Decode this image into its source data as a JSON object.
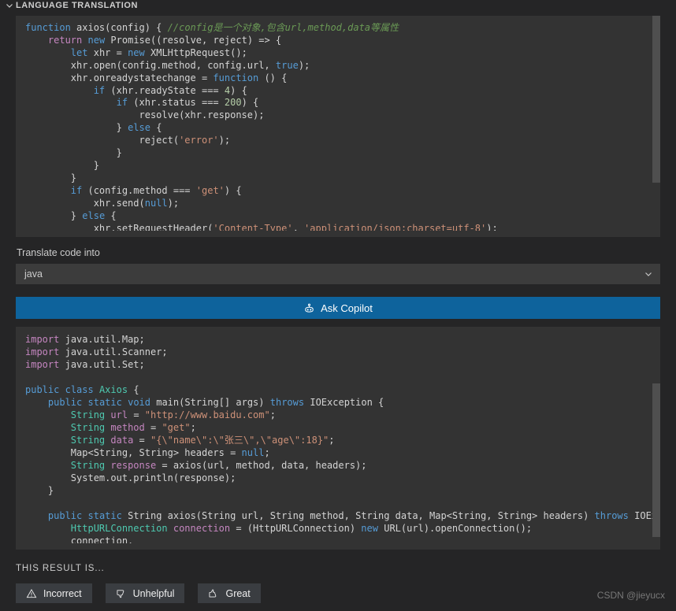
{
  "section": {
    "title": "LANGUAGE TRANSLATION",
    "chevron_icon": "chevron-down-icon"
  },
  "source_code": {
    "language": "javascript",
    "scrollbar": "vertical-scrollbar",
    "text": "function axios(config) { //config是一个对象,包含url,method,data等属性\n    return new Promise((resolve, reject) => {\n        let xhr = new XMLHttpRequest();\n        xhr.open(config.method, config.url, true);\n        xhr.onreadystatechange = function () {\n            if (xhr.readyState === 4) {\n                if (xhr.status === 200) {\n                    resolve(xhr.response);\n                } else {\n                    reject('error');\n                }\n            }\n        }\n        if (config.method === 'get') {\n            xhr.send(null);\n        } else {\n            xhr.setRequestHeader('Content-Type', 'application/json;charset=utf-8');"
  },
  "form": {
    "label": "Translate code into",
    "selected_language": "java",
    "chevron_icon": "chevron-down-icon",
    "submit_label": "Ask Copilot",
    "submit_icon": "copilot-icon",
    "accent_color": "#0e639c"
  },
  "result_code": {
    "language": "java",
    "scrollbar": "vertical-scrollbar",
    "text": "import java.util.Map;\nimport java.util.Scanner;\nimport java.util.Set;\n\npublic class Axios {\n    public static void main(String[] args) throws IOException {\n        String url = \"http://www.baidu.com\";\n        String method = \"get\";\n        String data = \"{\\\"name\\\":\\\"张三\\\",\\\"age\\\":18}\";\n        Map<String, String> headers = null;\n        String response = axios(url, method, data, headers);\n        System.out.println(response);\n    }\n\n    public static String axios(String url, String method, String data, Map<String, String> headers) throws IOException {\n        HttpURLConnection connection = (HttpURLConnection) new URL(url).openConnection();\n        connection."
  },
  "feedback": {
    "label": "THIS RESULT IS...",
    "buttons": [
      {
        "label": "Incorrect",
        "icon": "warning-triangle-icon"
      },
      {
        "label": "Unhelpful",
        "icon": "thumbs-down-icon"
      },
      {
        "label": "Great",
        "icon": "thumbs-up-icon"
      }
    ]
  },
  "watermark": "CSDN @jieyucx"
}
